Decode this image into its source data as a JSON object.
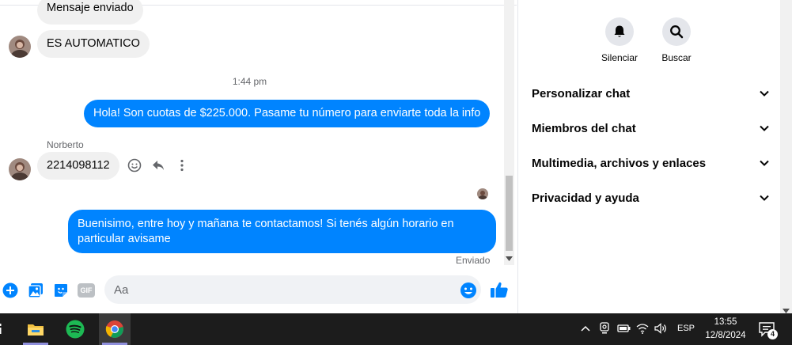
{
  "colors": {
    "accent": "#0084ff",
    "incoming_bubble": "#f0f0f0",
    "taskbar": "#1c1c1c"
  },
  "chat": {
    "messages": [
      {
        "direction": "in",
        "text": "Mensaje enviado"
      },
      {
        "direction": "in",
        "text": "ES AUTOMATICO"
      },
      {
        "direction": "timestamp",
        "text": "1:44 pm"
      },
      {
        "direction": "out",
        "text": "Hola! Son cuotas de $225.000. Pasame tu número para enviarte toda la info"
      },
      {
        "direction": "sender",
        "text": "Norberto"
      },
      {
        "direction": "in",
        "text": "2214098112"
      },
      {
        "direction": "out",
        "text": "Buenisimo, entre hoy y mañana te contactamos! Si tenés algún horario en",
        "text_line2": "particular avisame"
      }
    ],
    "message_actions": [
      "smiley-icon",
      "reply-icon",
      "more-icon"
    ],
    "status": "Enviado"
  },
  "composer": {
    "placeholder": "Aa",
    "icons": [
      "plus-icon",
      "image-icon",
      "sticker-icon",
      "gif-icon",
      "emoji-icon",
      "thumbs-up-icon"
    ],
    "gif_label": "GIF"
  },
  "info_panel": {
    "actions": [
      {
        "label": "Silenciar",
        "icon": "bell-icon"
      },
      {
        "label": "Buscar",
        "icon": "search-icon"
      }
    ],
    "sections": [
      {
        "label": "Personalizar chat"
      },
      {
        "label": "Miembros del chat"
      },
      {
        "label": "Multimedia, archivos y enlaces"
      },
      {
        "label": "Privacidad y ayuda"
      }
    ]
  },
  "taskbar": {
    "apps": [
      "file-explorer-icon",
      "spotify-icon",
      "chrome-icon"
    ],
    "tray_icons": [
      "chevron-up-icon",
      "webcam-icon",
      "battery-icon",
      "wifi-icon",
      "volume-icon"
    ],
    "language": "ESP",
    "time": "13:55",
    "date": "12/8/2024",
    "notification_count": "4"
  }
}
